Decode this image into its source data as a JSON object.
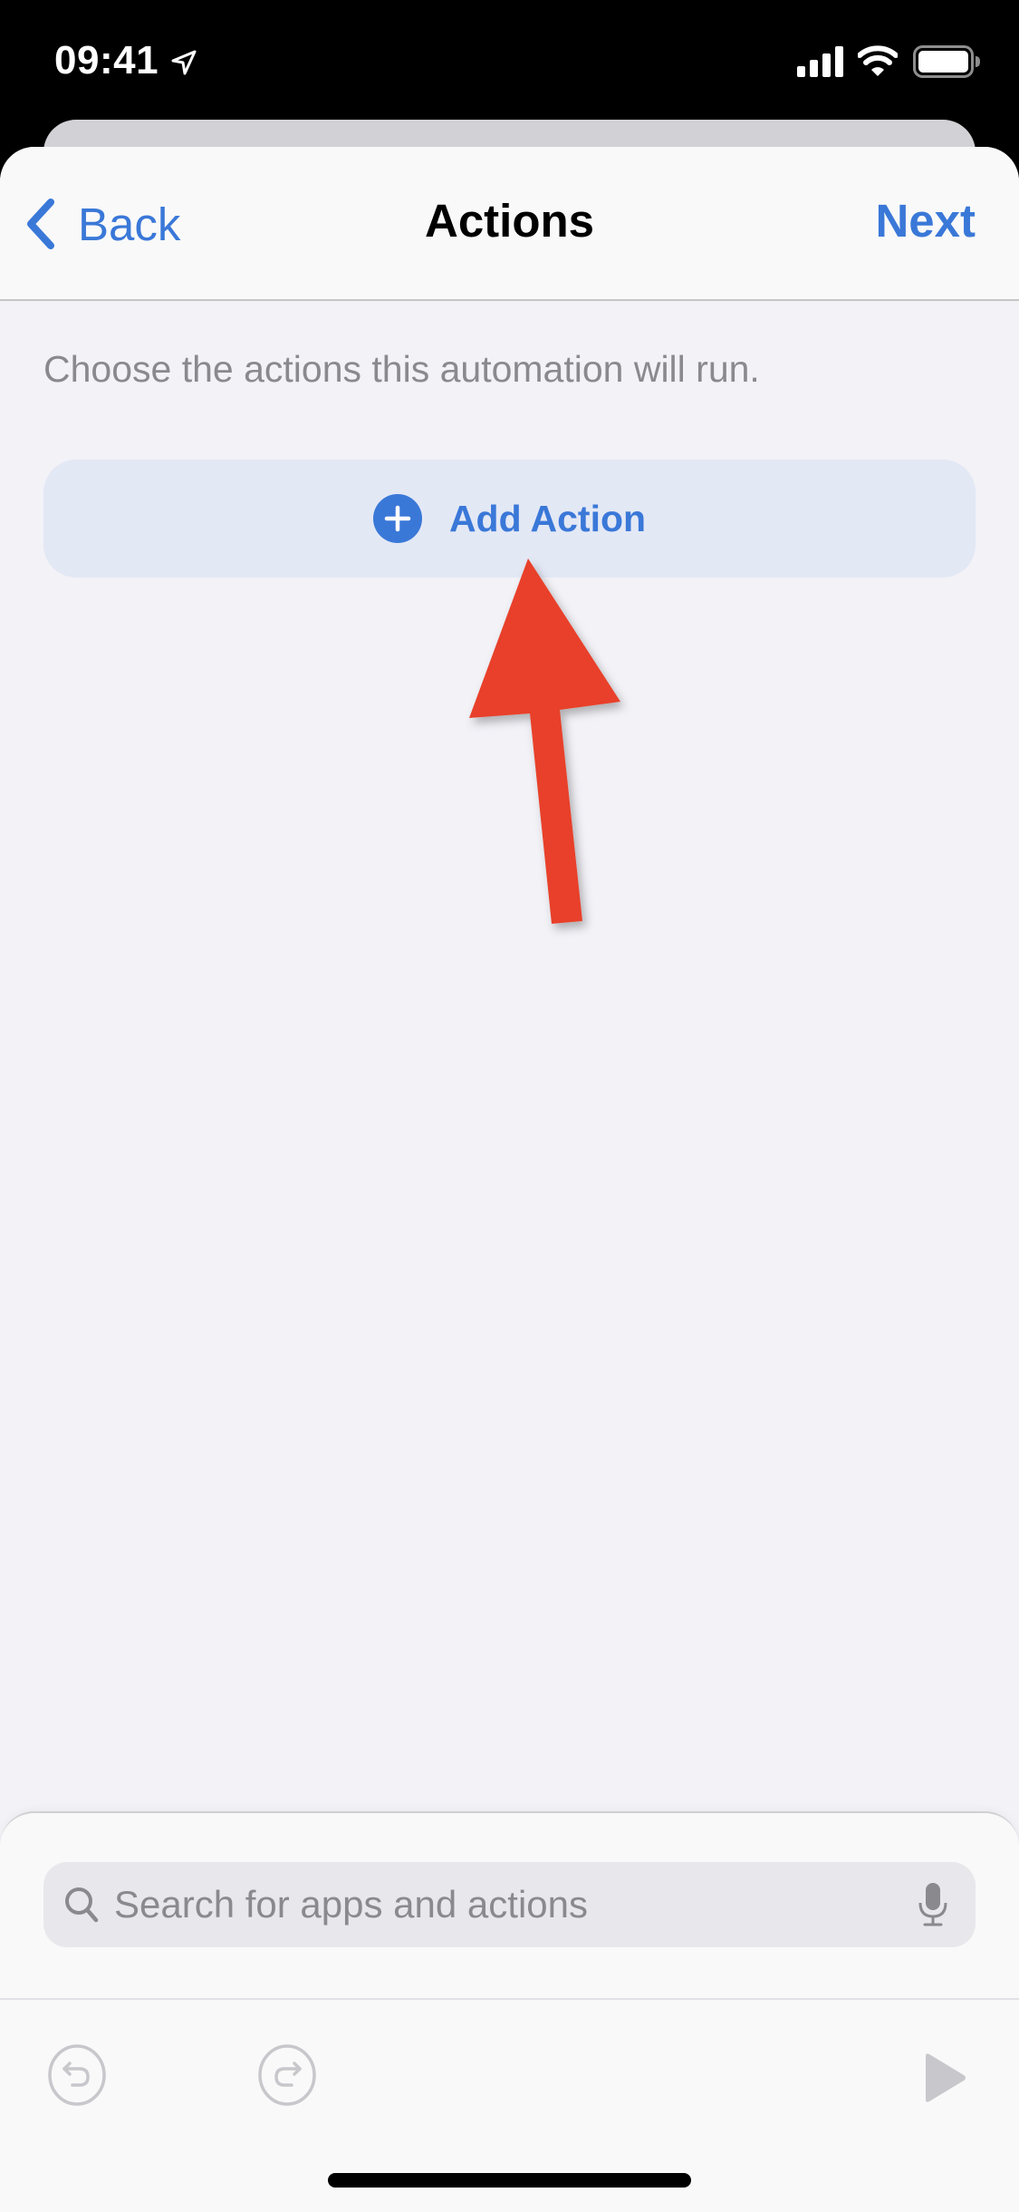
{
  "status_bar": {
    "time": "09:41",
    "location_icon": "location-arrow-icon",
    "signal_icon": "cellular-signal-icon",
    "wifi_icon": "wifi-icon",
    "battery_icon": "battery-full-icon"
  },
  "nav": {
    "back_label": "Back",
    "title": "Actions",
    "next_label": "Next"
  },
  "main": {
    "description": "Choose the actions this automation will run.",
    "add_action_label": "Add Action"
  },
  "annotation": {
    "type": "red-arrow",
    "points_to": "Add Action",
    "color": "#e8402a"
  },
  "search": {
    "placeholder": "Search for apps and actions",
    "value": ""
  },
  "toolbar": {
    "undo_icon": "undo-icon",
    "redo_icon": "redo-icon",
    "play_icon": "play-icon"
  },
  "colors": {
    "accent": "#3a78d8",
    "background": "#f2f2f7",
    "secondary_text": "#8a8a8e",
    "add_action_bg": "#e3e8f5",
    "disabled_icon": "#c7c7cc"
  }
}
